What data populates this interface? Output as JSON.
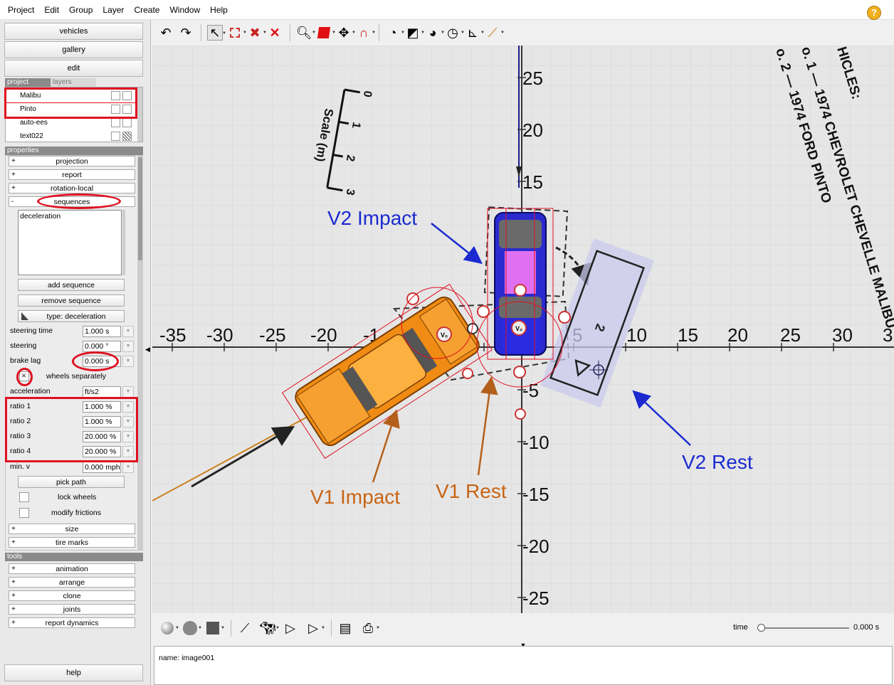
{
  "menu": [
    "Project",
    "Edit",
    "Group",
    "Layer",
    "Create",
    "Window",
    "Help"
  ],
  "left": {
    "vehicles": "vehicles",
    "gallery": "gallery",
    "edit": "edit",
    "tab_project": "project",
    "tab_layers": "layers",
    "items": [
      {
        "label": "Malibu"
      },
      {
        "label": "Pinto"
      },
      {
        "label": "auto-ees"
      },
      {
        "label": "text022"
      }
    ],
    "properties": "properties",
    "projection": "projection",
    "report": "report",
    "rotation": "rotation-local",
    "sequences": "sequences",
    "seq_item": "deceleration",
    "add_seq": "add sequence",
    "remove_seq": "remove sequence",
    "type": "type: deceleration",
    "steering_time_label": "steering time",
    "steering_time": "1.000 s",
    "steering_label": "steering",
    "steering": "0.000 °",
    "brake_lag_label": "brake lag",
    "brake_lag": "0.000 s",
    "wheels_sep": "wheels separately",
    "accel_label": "acceleration",
    "accel_unit": "ft/s2",
    "ratios": [
      {
        "label": "ratio 1",
        "value": "1.000 %"
      },
      {
        "label": "ratio 2",
        "value": "1.000 %"
      },
      {
        "label": "ratio 3",
        "value": "20.000 %"
      },
      {
        "label": "ratio 4",
        "value": "20.000 %"
      }
    ],
    "minv_label": "min. v",
    "minv": "0.000 mph",
    "pick_path": "pick path",
    "lock_wheels": "lock wheels",
    "modify_frictions": "modify frictions",
    "size": "size",
    "tire_marks": "tire marks",
    "tools": "tools",
    "tool_items": [
      "animation",
      "arrange",
      "clone",
      "joints",
      "report dynamics"
    ],
    "help": "help"
  },
  "canvas": {
    "x_ticks": [
      "-35",
      "-30",
      "-25",
      "-20",
      "-1",
      "5",
      "10",
      "15",
      "20",
      "25",
      "30",
      "3"
    ],
    "y_ticks": [
      "25",
      "20",
      "15",
      "-5",
      "-10",
      "-15",
      "-20",
      "-25"
    ],
    "scale_title": "Scale (m)",
    "scale_ticks": [
      "0",
      "1",
      "2",
      "3"
    ],
    "vehicles_text": [
      "HICLES:",
      "o. 1 — 1974 CHEVROLET CHEVELLE MALIBU",
      "o. 2 — 1974 FORD PINTO"
    ],
    "labels": {
      "v2_impact": "V2 Impact",
      "v2_rest": "V2 Rest",
      "v1_impact": "V1 Impact",
      "v1_rest": "V1 Rest"
    },
    "colors": {
      "blue_label": "#1a2ad0",
      "orange_label": "#c86414",
      "highlight": "#e01020"
    }
  },
  "time": {
    "label": "time",
    "value": "0.000 s",
    "position": 0
  },
  "status": {
    "name": "name: image001"
  },
  "icons": {
    "toolbar": [
      "undo-icon",
      "redo-icon",
      "select-arrow-icon",
      "rect-select-icon",
      "delete-x-icon",
      "delete-red-x-icon",
      "zoom-icon",
      "cube-icon",
      "move-icon",
      "magnet-icon",
      "gauge-icon",
      "ramp-icon",
      "dial-icon",
      "protractor-icon",
      "axis-icon",
      "measure-icon",
      "help-icon"
    ],
    "bottom": [
      "sphere-icon",
      "shield-icon",
      "square-icon",
      "graph-icon",
      "animal-icon",
      "play-icon",
      "play-list-icon",
      "report-icon",
      "print-icon"
    ]
  }
}
